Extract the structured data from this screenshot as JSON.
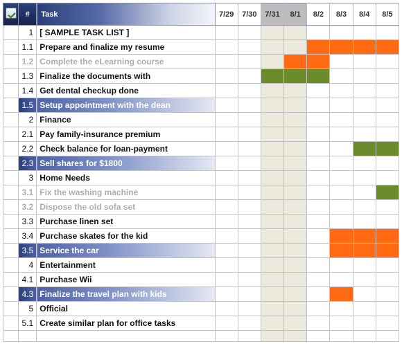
{
  "chart_data": {
    "type": "table",
    "title": "Task",
    "columns": [
      "7/29",
      "7/30",
      "7/31",
      "8/1",
      "8/2",
      "8/3",
      "8/4",
      "8/5"
    ],
    "weekend_columns": [
      2,
      3
    ],
    "tasks": [
      {
        "num": "1",
        "label": "[ SAMPLE TASK LIST ]",
        "style": "normal",
        "bars": []
      },
      {
        "num": "1.1",
        "label": "Prepare and finalize my resume",
        "style": "normal",
        "bars": [
          {
            "from": 4,
            "to": 7,
            "color": "orange"
          }
        ]
      },
      {
        "num": "1.2",
        "label": "Complete the eLearning course",
        "style": "disabled",
        "bars": [
          {
            "from": 3,
            "to": 4,
            "color": "orange"
          }
        ]
      },
      {
        "num": "1.3",
        "label": "Finalize the documents with",
        "style": "normal",
        "bars": [
          {
            "from": 2,
            "to": 4,
            "color": "green"
          }
        ]
      },
      {
        "num": "1.4",
        "label": "Get dental checkup done",
        "style": "normal",
        "bars": []
      },
      {
        "num": "1.5",
        "label": "Setup appointment with the dean",
        "style": "highlight",
        "bars": []
      },
      {
        "num": "2",
        "label": "Finance",
        "style": "normal",
        "bars": []
      },
      {
        "num": "2.1",
        "label": "Pay family-insurance premium",
        "style": "normal",
        "bars": []
      },
      {
        "num": "2.2",
        "label": "Check balance for loan-payment",
        "style": "normal",
        "bars": [
          {
            "from": 6,
            "to": 7,
            "color": "green"
          }
        ]
      },
      {
        "num": "2.3",
        "label": "Sell shares for $1800",
        "style": "highlight",
        "bars": []
      },
      {
        "num": "3",
        "label": "Home Needs",
        "style": "normal",
        "bars": []
      },
      {
        "num": "3.1",
        "label": "Fix the washing machine",
        "style": "disabled",
        "bars": [
          {
            "from": 7,
            "to": 7,
            "color": "green"
          }
        ]
      },
      {
        "num": "3.2",
        "label": "Dispose the old sofa set",
        "style": "disabled",
        "bars": []
      },
      {
        "num": "3.3",
        "label": "Purchase linen set",
        "style": "normal",
        "bars": []
      },
      {
        "num": "3.4",
        "label": "Purchase skates for the kid",
        "style": "normal",
        "bars": [
          {
            "from": 5,
            "to": 7,
            "color": "orange"
          }
        ]
      },
      {
        "num": "3.5",
        "label": "Service the car",
        "style": "highlight",
        "bars": [
          {
            "from": 5,
            "to": 7,
            "color": "orange"
          }
        ]
      },
      {
        "num": "4",
        "label": "Entertainment",
        "style": "normal",
        "bars": []
      },
      {
        "num": "4.1",
        "label": "Purchase Wii",
        "style": "normal",
        "bars": []
      },
      {
        "num": "4.3",
        "label": "Finalize the travel plan with kids",
        "style": "highlight",
        "bars": [
          {
            "from": 5,
            "to": 5,
            "color": "orange"
          }
        ]
      },
      {
        "num": "5",
        "label": "Official",
        "style": "normal",
        "bars": []
      },
      {
        "num": "5.1",
        "label": "Create similar plan for office tasks",
        "style": "normal",
        "bars": []
      }
    ]
  },
  "header": {
    "num_symbol": "#",
    "task_label": "Task"
  }
}
